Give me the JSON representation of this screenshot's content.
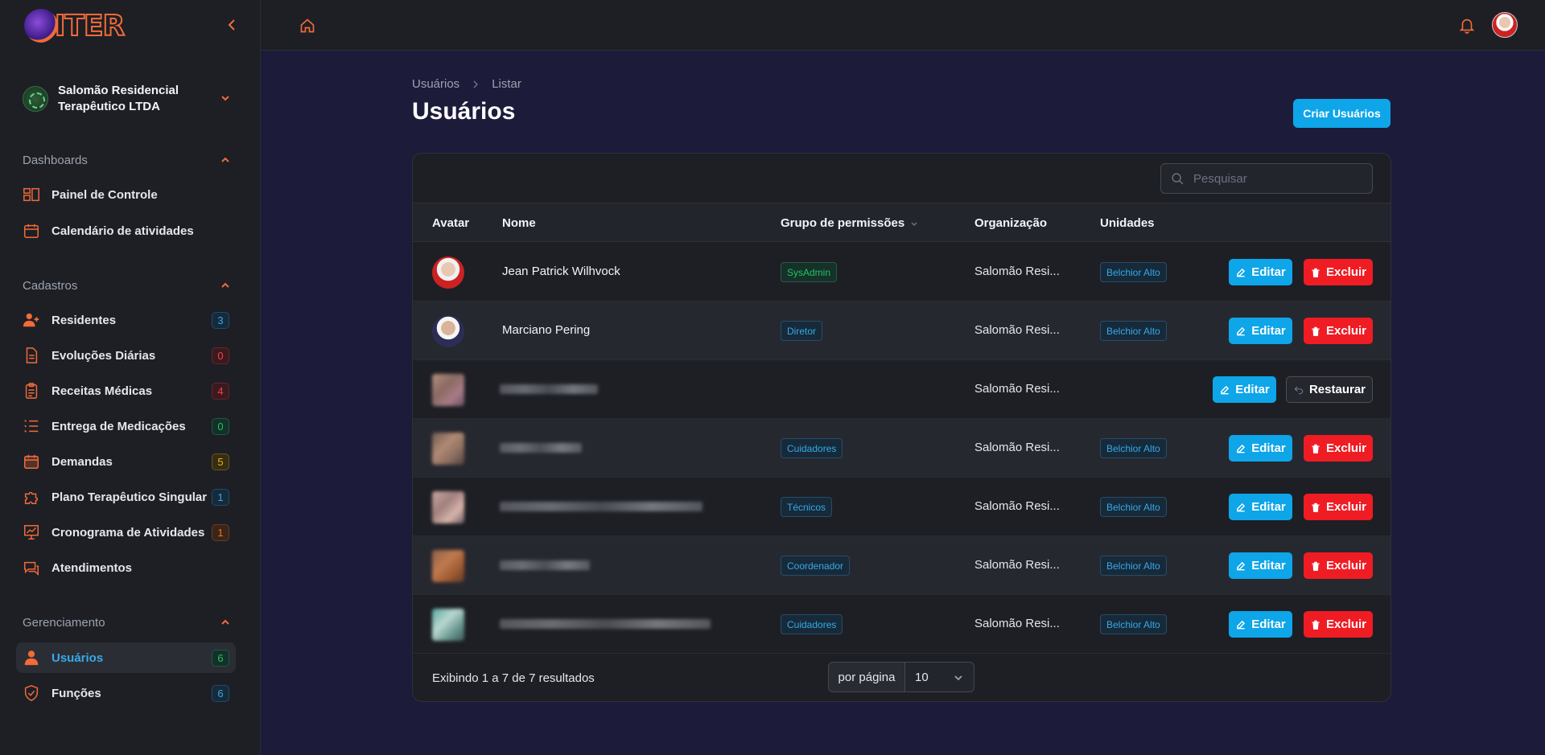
{
  "brand": {
    "logo_text": "ITER"
  },
  "organization": {
    "name": "Salomão Residencial Terapêutico LTDA"
  },
  "sidebar": {
    "sections": [
      {
        "title": "Dashboards",
        "items": [
          {
            "label": "Painel de Controle",
            "icon": "dashboard-icon"
          },
          {
            "label": "Calendário de atividades",
            "icon": "calendar-icon"
          }
        ]
      },
      {
        "title": "Cadastros",
        "items": [
          {
            "label": "Residentes",
            "icon": "user-plus-icon",
            "badge": "3"
          },
          {
            "label": "Evoluções Diárias",
            "icon": "document-icon",
            "badge": "0"
          },
          {
            "label": "Receitas Médicas",
            "icon": "clipboard-icon",
            "badge": "4"
          },
          {
            "label": "Entrega de Medicações",
            "icon": "list-icon",
            "badge": "0"
          },
          {
            "label": "Demandas",
            "icon": "calendar-task-icon",
            "badge": "5"
          },
          {
            "label": "Plano Terapêutico Singular",
            "icon": "puzzle-icon",
            "badge": "1"
          },
          {
            "label": "Cronograma de Atividades",
            "icon": "presentation-chart-icon",
            "badge": "1"
          },
          {
            "label": "Atendimentos",
            "icon": "chat-icon"
          }
        ]
      },
      {
        "title": "Gerenciamento",
        "items": [
          {
            "label": "Usuários",
            "icon": "user-icon",
            "badge": "6",
            "active": true
          },
          {
            "label": "Funções",
            "icon": "shield-icon",
            "badge": "6"
          }
        ]
      }
    ]
  },
  "breadcrumb": {
    "items": [
      "Usuários",
      "Listar"
    ]
  },
  "page": {
    "title": "Usuários",
    "create_button": "Criar Usuários"
  },
  "search": {
    "placeholder": "Pesquisar"
  },
  "table": {
    "columns": [
      "Avatar",
      "Nome",
      "Grupo de permissões",
      "Organização",
      "Unidades"
    ],
    "rows": [
      {
        "name": "Jean Patrick Wilhvock",
        "group": "SysAdmin",
        "organization": "Salomão Resi...",
        "unit": "Belchior Alto",
        "actions": [
          "Editar",
          "Excluir"
        ]
      },
      {
        "name": "Marciano Pering",
        "group": "Diretor",
        "organization": "Salomão Resi...",
        "unit": "Belchior Alto",
        "actions": [
          "Editar",
          "Excluir"
        ]
      },
      {
        "name": "",
        "group": "",
        "organization": "Salomão Resi...",
        "unit": "",
        "actions": [
          "Editar",
          "Restaurar"
        ]
      },
      {
        "name": "",
        "group": "Cuidadores",
        "organization": "Salomão Resi...",
        "unit": "Belchior Alto",
        "actions": [
          "Editar",
          "Excluir"
        ]
      },
      {
        "name": "",
        "group": "Técnicos",
        "organization": "Salomão Resi...",
        "unit": "Belchior Alto",
        "actions": [
          "Editar",
          "Excluir"
        ]
      },
      {
        "name": "",
        "group": "Coordenador",
        "organization": "Salomão Resi...",
        "unit": "Belchior Alto",
        "actions": [
          "Editar",
          "Excluir"
        ]
      },
      {
        "name": "",
        "group": "Cuidadores",
        "organization": "Salomão Resi...",
        "unit": "Belchior Alto",
        "actions": [
          "Editar",
          "Excluir"
        ]
      }
    ]
  },
  "pagination": {
    "summary": "Exibindo 1 a 7 de 7 resultados",
    "per_page_label": "por página",
    "per_page_value": "10"
  },
  "colors": {
    "accent": "#f26b38",
    "primary": "#0ea5e9",
    "danger": "#ef1c24"
  }
}
